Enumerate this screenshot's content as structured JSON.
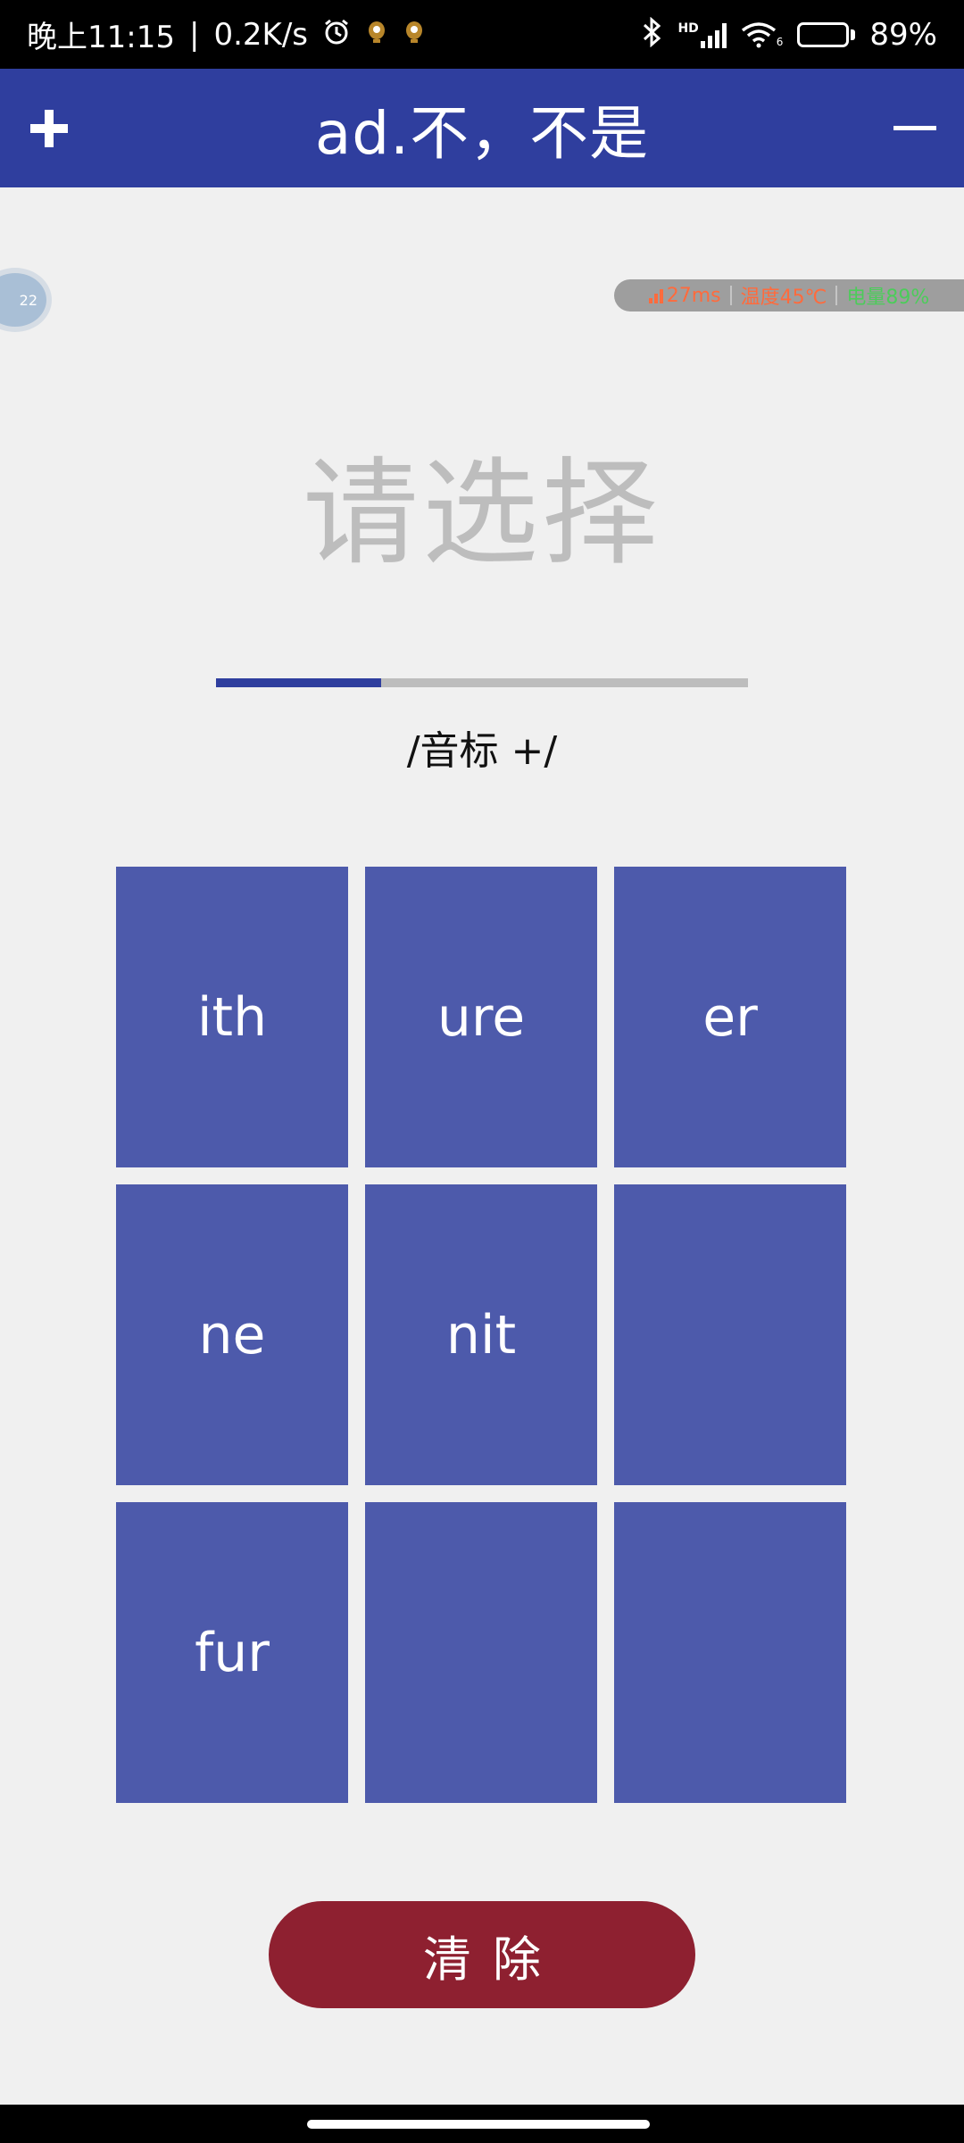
{
  "status_bar": {
    "time": "晚上11:15",
    "network_speed": "0.2K/s",
    "separator": "|",
    "battery_percent": "89%",
    "battery_level": 0.89,
    "icons": [
      "alarm-icon",
      "notification-icon",
      "notification-icon",
      "bluetooth-icon",
      "signal-icon",
      "wifi-icon",
      "battery-icon"
    ],
    "signal_tag": "HD",
    "wifi_tag": "6"
  },
  "header": {
    "title": "ad.不，不是",
    "add_icon": "plus-icon",
    "remove_icon": "minus-icon"
  },
  "floating_ball": {
    "text": "22"
  },
  "perf_overlay": {
    "ping": "27ms",
    "temperature": "温度45℃",
    "battery": "电量89%",
    "colors": {
      "ping": "#ff6b3d",
      "temperature": "#ff6b3d",
      "battery": "#4ccc5a"
    }
  },
  "prompt": {
    "text": "请选择"
  },
  "progress": {
    "value": 0.31
  },
  "phonetic": {
    "text": "/音标 +/"
  },
  "tiles": [
    "ith",
    "ure",
    "er",
    "ne",
    "nit",
    "",
    "fur",
    "",
    ""
  ],
  "clear_button": {
    "label": "清除"
  },
  "colors": {
    "primary": "#2f3e9e",
    "tile": "#4d5aab",
    "clear": "#8e2030",
    "background": "#f0f0f0"
  }
}
